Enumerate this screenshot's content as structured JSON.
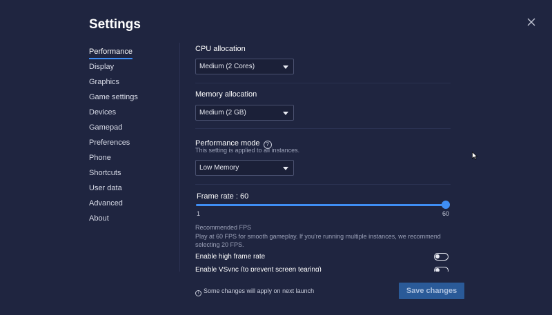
{
  "title": "Settings",
  "sidebar": {
    "items": [
      {
        "label": "Performance",
        "active": true
      },
      {
        "label": "Display"
      },
      {
        "label": "Graphics"
      },
      {
        "label": "Game settings"
      },
      {
        "label": "Devices"
      },
      {
        "label": "Gamepad"
      },
      {
        "label": "Preferences"
      },
      {
        "label": "Phone"
      },
      {
        "label": "Shortcuts"
      },
      {
        "label": "User data"
      },
      {
        "label": "Advanced"
      },
      {
        "label": "About"
      }
    ]
  },
  "cpu": {
    "label": "CPU allocation",
    "value": "Medium (2 Cores)"
  },
  "memory": {
    "label": "Memory allocation",
    "value": "Medium (2 GB)"
  },
  "perf_mode": {
    "label": "Performance mode",
    "help": "?",
    "sublabel": "This setting is applied to all instances.",
    "value": "Low Memory"
  },
  "frame_rate": {
    "label": "Frame rate : 60",
    "min": "1",
    "max": "60",
    "value": 60,
    "min_value": 1,
    "max_value": 60,
    "recommended_title": "Recommended FPS",
    "recommended_text": "Play at 60 FPS for smooth gameplay. If you're running multiple instances, we recommend selecting 20 FPS."
  },
  "toggles": {
    "high_frame_rate": "Enable high frame rate",
    "vsync": "Enable VSync (to prevent screen tearing)"
  },
  "footer": {
    "info_glyph": "i",
    "note": "Some changes will apply on next launch",
    "save_label": "Save changes"
  },
  "colors": {
    "background": "#1f2540",
    "accent": "#3f8ef5",
    "save_button": "#2a5a98"
  }
}
